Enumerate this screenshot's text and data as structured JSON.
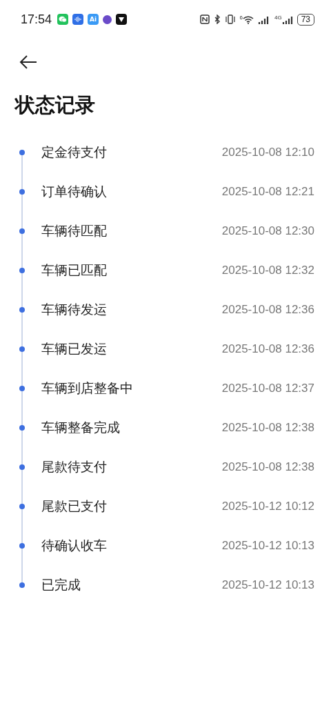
{
  "status_bar": {
    "time": "17:54",
    "ai_badge": "Ai",
    "wifi_badge": "6",
    "network": "4G",
    "battery": "73"
  },
  "title": "状态记录",
  "records": [
    {
      "status": "定金待支付",
      "time": "2025-10-08 12:10"
    },
    {
      "status": "订单待确认",
      "time": "2025-10-08 12:21"
    },
    {
      "status": "车辆待匹配",
      "time": "2025-10-08 12:30"
    },
    {
      "status": "车辆已匹配",
      "time": "2025-10-08 12:32"
    },
    {
      "status": "车辆待发运",
      "time": "2025-10-08 12:36"
    },
    {
      "status": "车辆已发运",
      "time": "2025-10-08 12:36"
    },
    {
      "status": "车辆到店整备中",
      "time": "2025-10-08 12:37"
    },
    {
      "status": "车辆整备完成",
      "time": "2025-10-08 12:38"
    },
    {
      "status": "尾款待支付",
      "time": "2025-10-08 12:38"
    },
    {
      "status": "尾款已支付",
      "time": "2025-10-12 10:12"
    },
    {
      "status": "待确认收车",
      "time": "2025-10-12 10:13"
    },
    {
      "status": "已完成",
      "time": "2025-10-12 10:13"
    }
  ]
}
